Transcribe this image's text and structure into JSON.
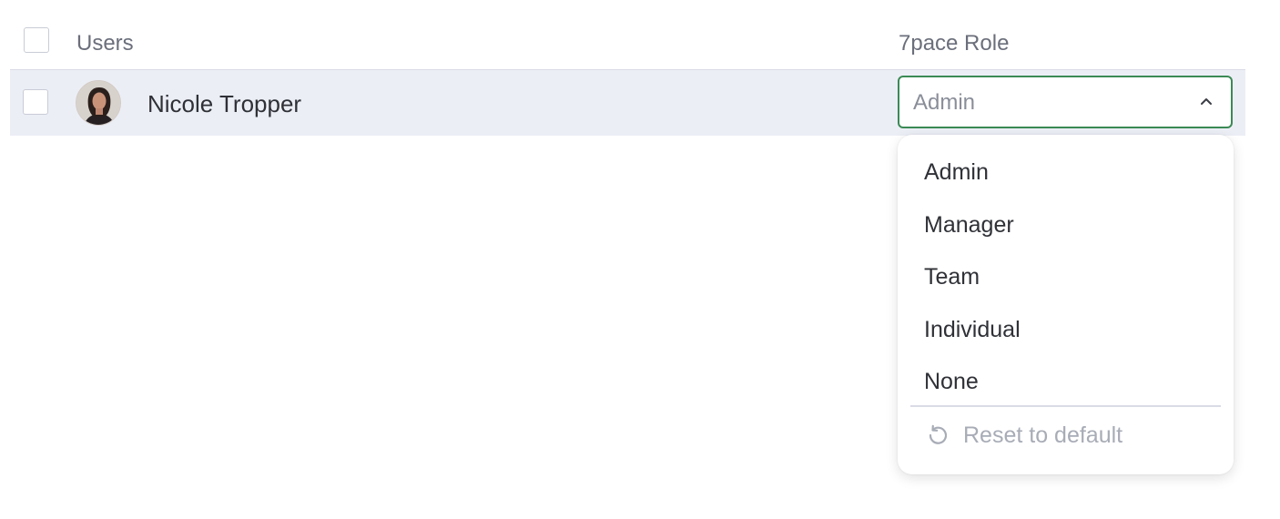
{
  "table": {
    "header": {
      "users_label": "Users",
      "role_label": "7pace Role"
    },
    "rows": [
      {
        "name": "Nicole Tropper",
        "role": "Admin"
      }
    ]
  },
  "role_dropdown": {
    "selected": "Admin",
    "options": [
      "Admin",
      "Manager",
      "Team",
      "Individual",
      "None"
    ],
    "reset_label": "Reset to default"
  },
  "icons": {
    "chevron": "chevron-up-icon",
    "reset": "reset-icon",
    "avatar": "user-avatar"
  },
  "colors": {
    "accent_border": "#3b8a55",
    "row_highlight": "#eceef6",
    "muted_text": "#a8acb6"
  }
}
